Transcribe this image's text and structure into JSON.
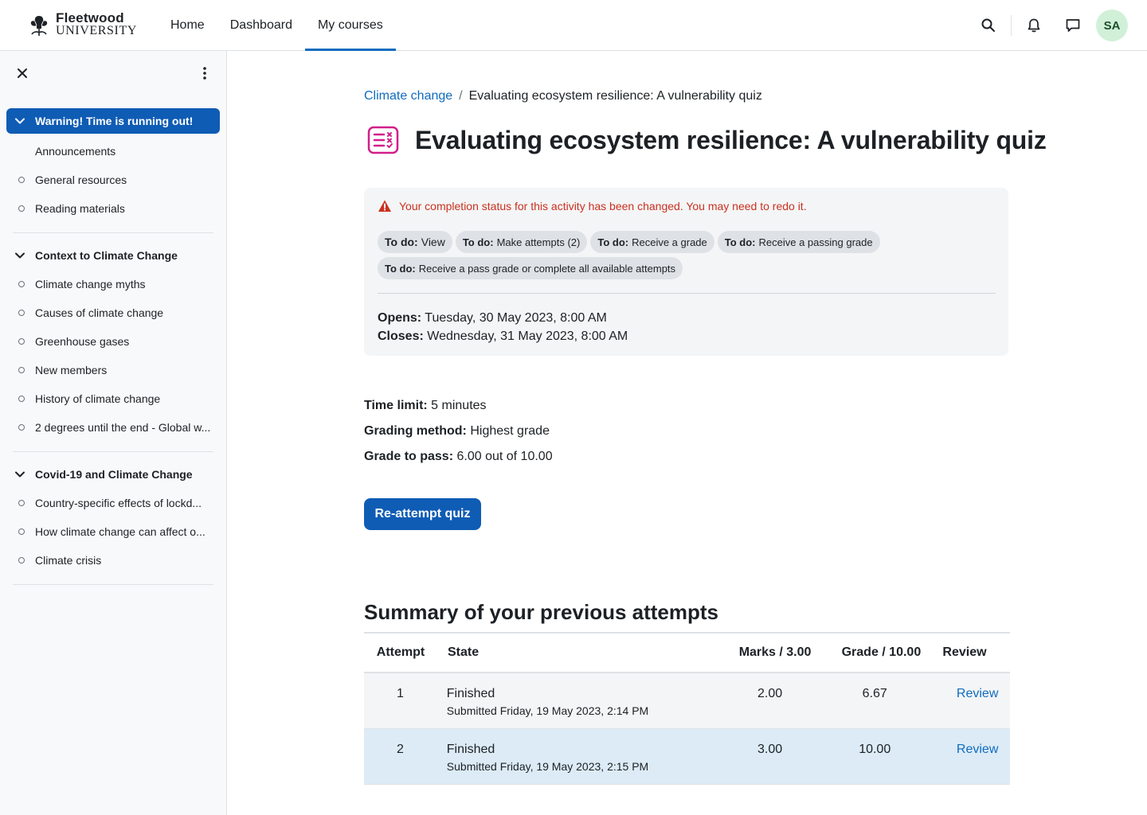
{
  "navbar": {
    "logo_line1": "Fleetwood",
    "logo_line2": "UNIVERSITY",
    "links": [
      {
        "label": "Home"
      },
      {
        "label": "Dashboard"
      },
      {
        "label": "My courses"
      }
    ],
    "avatar_initials": "SA",
    "icons": [
      "search-icon",
      "bell-icon",
      "message-icon"
    ]
  },
  "sidebar": {
    "sections": [
      {
        "title": "Warning! Time is running out!",
        "items": [
          "Announcements",
          "General resources",
          "Reading materials"
        ]
      },
      {
        "title": "Context to Climate Change",
        "items": [
          "Climate change myths",
          "Causes of climate change",
          "Greenhouse gases",
          "New members",
          "History of climate change",
          "2 degrees until the end - Global w..."
        ]
      },
      {
        "title": "Covid-19 and Climate Change",
        "items": [
          "Country-specific effects of lockd...",
          "How climate change can affect o...",
          "Climate crisis"
        ]
      }
    ]
  },
  "breadcrumb": {
    "parent": "Climate change",
    "separator": "/",
    "current": "Evaluating ecosystem resilience: A vulnerability quiz"
  },
  "page_title": "Evaluating ecosystem resilience: A vulnerability quiz",
  "completion": {
    "warning": "Your completion status for this activity has been changed. You may need to redo it.",
    "badges": [
      {
        "prefix": "To do:",
        "text": "View"
      },
      {
        "prefix": "To do:",
        "text": "Make attempts (2)"
      },
      {
        "prefix": "To do:",
        "text": "Receive a grade"
      },
      {
        "prefix": "To do:",
        "text": "Receive a passing grade"
      },
      {
        "prefix": "To do:",
        "text": "Receive a pass grade or complete all available attempts"
      }
    ],
    "opens_label": "Opens:",
    "opens_value": "Tuesday, 30 May 2023, 8:00 AM",
    "closes_label": "Closes:",
    "closes_value": "Wednesday, 31 May 2023, 8:00 AM"
  },
  "quiz_info": {
    "time_limit_label": "Time limit:",
    "time_limit_value": "5 minutes",
    "grading_label": "Grading method:",
    "grading_value": "Highest grade",
    "pass_label": "Grade to pass:",
    "pass_value": "6.00 out of 10.00"
  },
  "reattempt_button": "Re-attempt quiz",
  "summary": {
    "title": "Summary of your previous attempts",
    "headers": [
      "Attempt",
      "State",
      "Marks / 3.00",
      "Grade / 10.00",
      "Review"
    ],
    "rows": [
      {
        "attempt": "1",
        "state": "Finished",
        "submitted": "Submitted Friday, 19 May 2023, 2:14 PM",
        "marks": "2.00",
        "grade": "6.67",
        "review": "Review"
      },
      {
        "attempt": "2",
        "state": "Finished",
        "submitted": "Submitted Friday, 19 May 2023, 2:15 PM",
        "marks": "3.00",
        "grade": "10.00",
        "review": "Review"
      }
    ]
  },
  "colors": {
    "primary": "#0f5cb5",
    "link": "#0f6cbf",
    "warning": "#ca3120",
    "quiz_icon": "#d21e8b",
    "highlight_row": "#dcebf6"
  }
}
